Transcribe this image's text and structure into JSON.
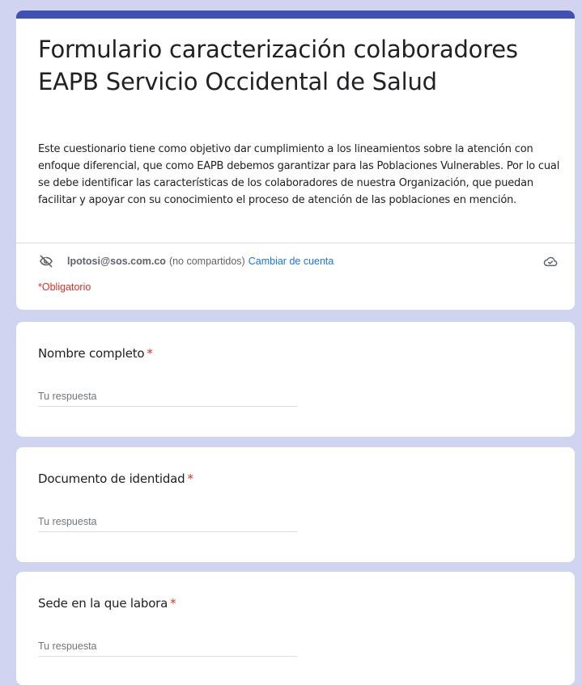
{
  "form": {
    "title": "Formulario caracterización colaboradores EAPB Servicio Occidental de Salud",
    "description": "Este cuestionario tiene como objetivo dar cumplimiento a los lineamientos sobre la atención con enfoque diferencial, que como EAPB debemos garantizar para las Poblaciones Vulnerables. Por lo cual se debe identificar las características de los colaboradores de nuestra Organización, que puedan facilitar y apoyar con su conocimiento el proceso de atención de las poblaciones en mención.",
    "accent_color": "#3f51b5",
    "background_color": "#d1d4f1"
  },
  "account": {
    "email": "lpotosi@sos.com.co",
    "sharing_status": "(no compartidos)",
    "switch_label": "Cambiar de cuenta",
    "privacy_icon": "eye-off-icon",
    "save_icon": "cloud-done-icon"
  },
  "required_note": "*Obligatorio",
  "questions": [
    {
      "label": "Nombre completo",
      "required_mark": "*",
      "placeholder": "Tu respuesta",
      "value": ""
    },
    {
      "label": "Documento de identidad",
      "required_mark": "*",
      "placeholder": "Tu respuesta",
      "value": ""
    },
    {
      "label": "Sede en la que labora",
      "required_mark": "*",
      "placeholder": "Tu respuesta",
      "value": ""
    }
  ]
}
